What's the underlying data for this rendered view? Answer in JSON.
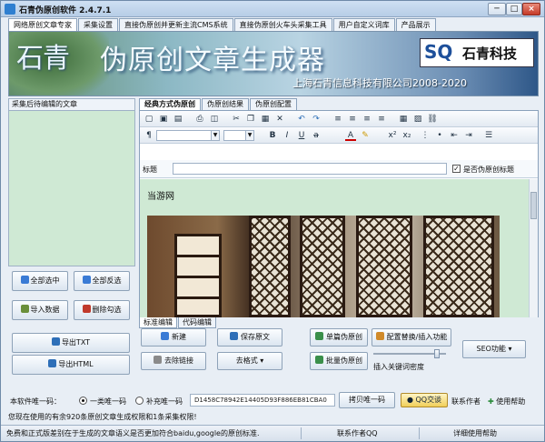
{
  "window": {
    "title": "石青伪原创软件 2.4.7.1",
    "min": "─",
    "max": "□",
    "close": "×"
  },
  "top_tabs": [
    "网络原创文章专家",
    "采集设置",
    "直接伪原创并更新主流CMS系统",
    "直接伪原创火车头采集工具",
    "用户自定义词库",
    "产品展示"
  ],
  "banner": {
    "logo_left": "石青",
    "title": "伪原创文章生成器",
    "subtitle": "上海石青信息科技有限公司2008-2020",
    "sq": "SQ",
    "brand": "石青科技"
  },
  "left": {
    "header": "采集后待编辑的文章",
    "select_all": "全部选中",
    "invert": "全部反选",
    "import": "导入数据",
    "delete_checked": "删除勾选",
    "export_txt": "导出TXT",
    "export_html": "导出HTML"
  },
  "right": {
    "tabs": [
      "经典方式伪原创",
      "伪原创结果",
      "伪原创配置"
    ],
    "title_label": "标题",
    "title_value": "",
    "pseudo_title_label": "是否伪原创标题",
    "pseudo_title_checked": true,
    "content_site": "当游网",
    "bottom_tabs": [
      "标准编辑",
      "代码编辑"
    ],
    "btn_new": "新建",
    "btn_save": "保存原文",
    "btn_single": "单篇伪原创",
    "btn_replace": "配置替换/插入功能",
    "btn_remove_links": "去除链接",
    "btn_format": "去格式",
    "btn_batch": "批量伪原创",
    "btn_seo": "SEO功能",
    "keyword_density_label": "插入关键词密度",
    "keyword_density_level": 0.9
  },
  "bottom": {
    "code_label": "本软件唯一码：",
    "radio1": "一类唯一码",
    "radio2": "补充唯一码",
    "code": "D1458C78942E14405D93F886EB81CBA0",
    "copy_btn": "拷贝唯一码",
    "qq_btn": "QQ交谈",
    "contact": "联系作者",
    "help": "使用帮助"
  },
  "notice": "您现在使用的有余920条原创文章生成权限和1条采集权限!",
  "status": {
    "s1": "免费和正式版差别在于生成的文章语义是否更加符合baidu,google的原创标准.",
    "s2": "联系作者QQ",
    "s3": "详细使用帮助"
  },
  "colors": {
    "editor_bg": "#cfe9d4",
    "accent": "#1d4f9a"
  }
}
